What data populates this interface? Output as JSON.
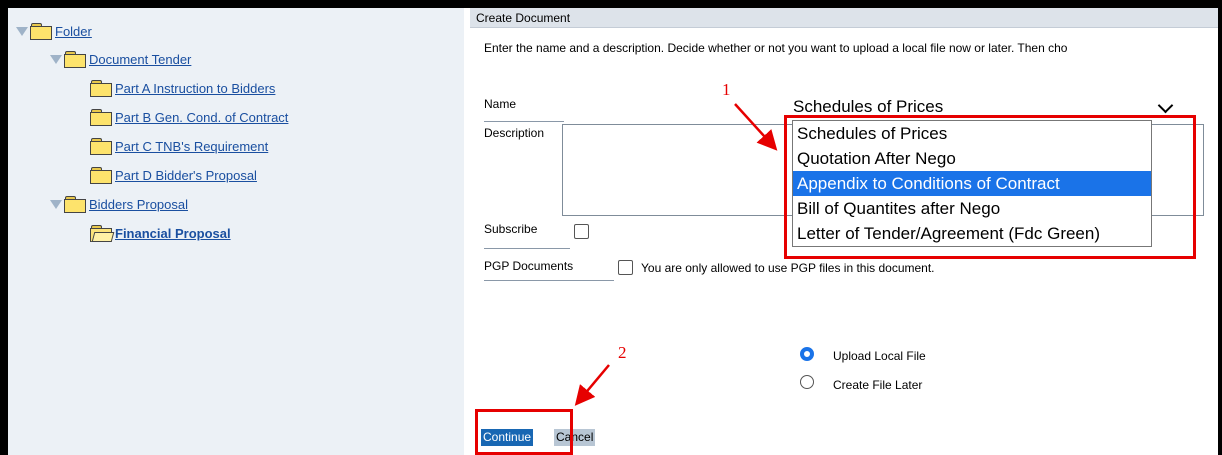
{
  "tree": {
    "items": [
      {
        "label": "Folder",
        "bold": false,
        "expanded": true
      },
      {
        "label": "Document Tender",
        "bold": false,
        "expanded": true
      },
      {
        "label": "Part A Instruction to Bidders",
        "bold": false
      },
      {
        "label": "Part B Gen. Cond. of Contract",
        "bold": false
      },
      {
        "label": "Part C TNB's Requirement",
        "bold": false
      },
      {
        "label": "Part D Bidder's Proposal",
        "bold": false
      },
      {
        "label": "Bidders Proposal",
        "bold": false,
        "expanded": true
      },
      {
        "label": "Financial Proposal",
        "bold": true,
        "open": true
      }
    ]
  },
  "form": {
    "title": "Create Document",
    "instructions": "Enter the name and a description. Decide whether or not you want to upload a local file now or later. Then cho",
    "name_label": "Name",
    "name_value": "Schedules of Prices",
    "description_label": "Description",
    "subscribe_label": "Subscribe",
    "pgp_label": "PGP Documents",
    "pgp_text": "You are only allowed to use PGP files in this document.",
    "name_options": [
      "Schedules of Prices",
      "Quotation After Nego",
      "Appendix to Conditions of Contract",
      "Bill of Quantites after Nego",
      "Letter of Tender/Agreement (Fdc Green)"
    ],
    "highlighted_option": "Appendix to Conditions of Contract",
    "upload_local_label": "Upload Local File",
    "create_later_label": "Create File Later",
    "selected_upload_mode": "Upload Local File",
    "continue_label": "Continue",
    "cancel_label": "Cancel"
  },
  "annotations": {
    "step1": "1",
    "step2": "2",
    "color": "#e60000"
  }
}
